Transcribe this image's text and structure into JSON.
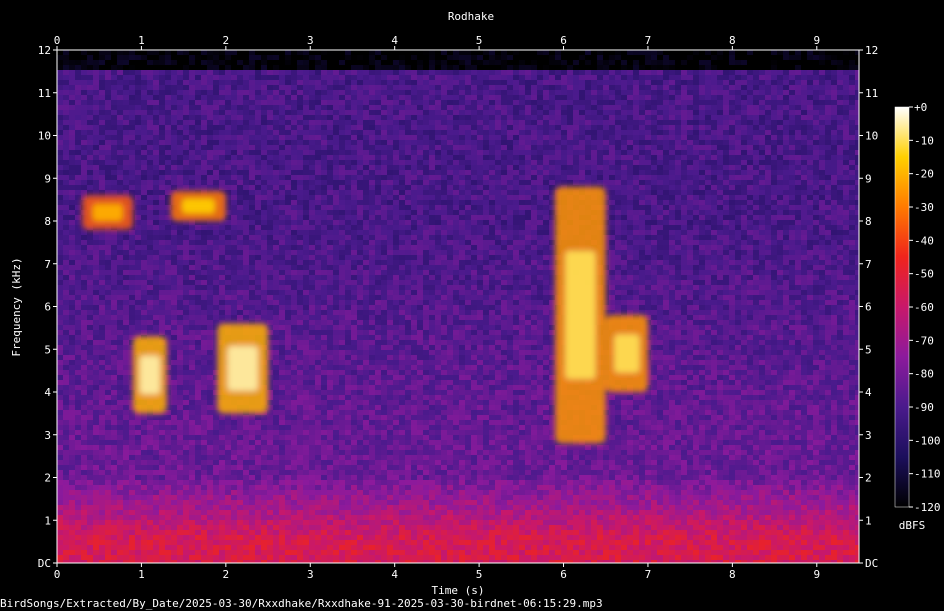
{
  "chart_data": {
    "type": "heatmap",
    "title": "Rodhake",
    "xlabel": "Time (s)",
    "ylabel": "Frequency (kHz)",
    "xlim": [
      0,
      9.5
    ],
    "ylim": [
      0,
      12
    ],
    "x_ticks": [
      "0",
      "1",
      "2",
      "3",
      "4",
      "5",
      "6",
      "7",
      "8",
      "9"
    ],
    "y_ticks": [
      "DC",
      "1",
      "2",
      "3",
      "4",
      "5",
      "6",
      "7",
      "8",
      "9",
      "10",
      "11",
      "12"
    ],
    "colorbar": {
      "label": "dBFS",
      "range": [
        -120,
        0
      ],
      "ticks": [
        "+0",
        "-10",
        "-20",
        "-30",
        "-40",
        "-50",
        "-60",
        "-70",
        "-80",
        "-90",
        "-100",
        "-110",
        "-120"
      ]
    },
    "grid": false,
    "palette": [
      "#000000",
      "#1c0f5c",
      "#4a1a8c",
      "#8c1a9c",
      "#c8186a",
      "#f0241c",
      "#ff7a00",
      "#ffd000",
      "#ffffff"
    ],
    "events": [
      {
        "t_start": 0.3,
        "t_end": 0.9,
        "f_low": 7.8,
        "f_high": 8.6,
        "peak_dbfs": -35
      },
      {
        "t_start": 0.9,
        "t_end": 1.3,
        "f_low": 3.5,
        "f_high": 5.3,
        "peak_dbfs": -20
      },
      {
        "t_start": 1.35,
        "t_end": 2.0,
        "f_low": 8.0,
        "f_high": 8.7,
        "peak_dbfs": -30
      },
      {
        "t_start": 1.9,
        "t_end": 2.5,
        "f_low": 3.5,
        "f_high": 5.6,
        "peak_dbfs": -20
      },
      {
        "t_start": 5.9,
        "t_end": 6.5,
        "f_low": 2.8,
        "f_high": 8.8,
        "peak_dbfs": -25
      },
      {
        "t_start": 6.5,
        "t_end": 7.0,
        "f_low": 4.0,
        "f_high": 5.8,
        "peak_dbfs": -25
      }
    ]
  },
  "footer": {
    "path": "BirdSongs/Extracted/By_Date/2025-03-30/Rxxdhake/Rxxdhake-91-2025-03-30-birdnet-06:15:29.mp3"
  }
}
